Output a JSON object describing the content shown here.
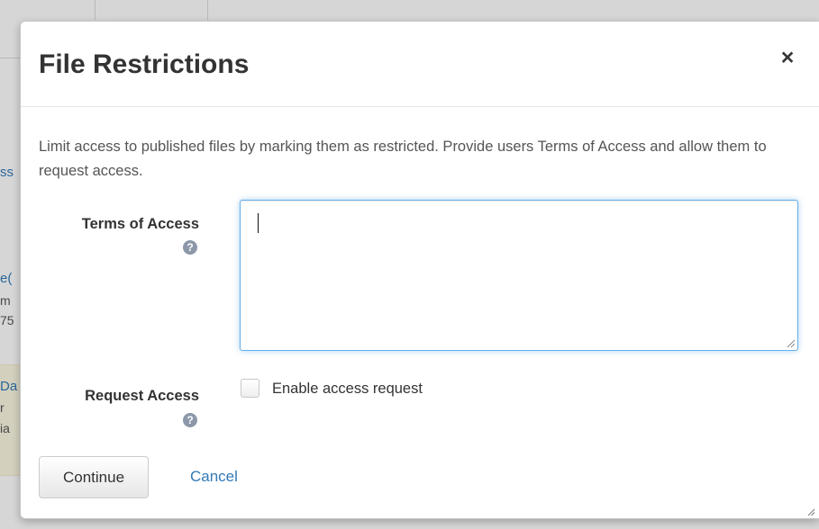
{
  "background": {
    "fragments": [
      {
        "text": "ss",
        "style": "link"
      },
      {
        "text": "e(",
        "style": "link"
      },
      {
        "text": "m",
        "style": "faint"
      },
      {
        "text": "75",
        "style": "faint"
      },
      {
        "text": "Da",
        "style": "link"
      },
      {
        "text": "r",
        "style": "faint"
      },
      {
        "text": "ia",
        "style": "faint"
      }
    ]
  },
  "modal": {
    "title": "File Restrictions",
    "close_label": "×",
    "intro_text": "Limit access to published files by marking them as restricted. Provide users Terms of Access and allow them to request access.",
    "terms_of_access": {
      "label": "Terms of Access",
      "help_icon": "question-circle-icon",
      "value": ""
    },
    "request_access": {
      "label": "Request Access",
      "help_icon": "question-circle-icon",
      "checkbox_label": "Enable access request",
      "checked": false
    },
    "buttons": {
      "continue_label": "Continue",
      "cancel_label": "Cancel"
    }
  },
  "colors": {
    "link": "#337ab7",
    "focus_border": "#66afe9",
    "help_icon": "#8c98a9",
    "title": "#333333",
    "body_text": "#555555"
  }
}
